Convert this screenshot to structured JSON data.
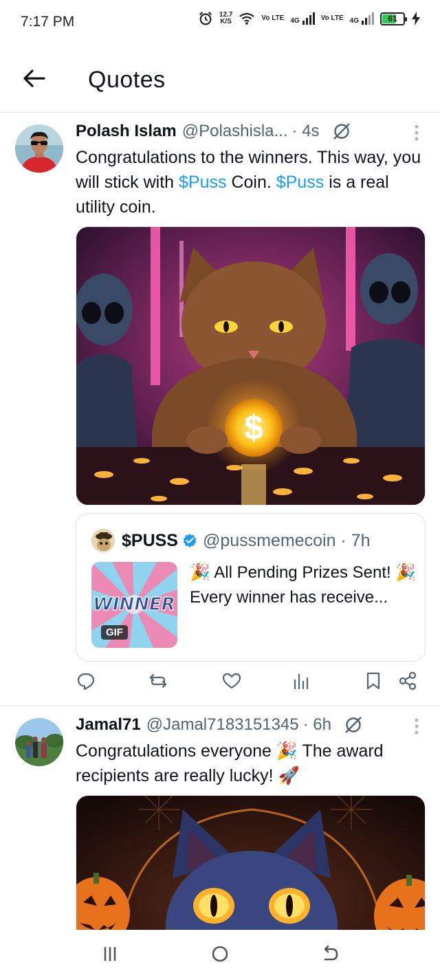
{
  "status_bar": {
    "time": "7:17 PM",
    "net_speed_value": "12.7",
    "net_speed_unit": "K/S",
    "sim1_label": "Vo LTE",
    "sim1_gen": "4G",
    "sim2_label": "Vo LTE",
    "sim2_gen": "4G",
    "battery_level": "61",
    "battery_fraction": 0.61
  },
  "header": {
    "title": "Quotes"
  },
  "posts": [
    {
      "author": "Polash Islam",
      "handle": "@Polashisla...",
      "time": "· 4s",
      "text_parts": [
        "Congratulations to the winners. This way, you will stick with ",
        "$Puss",
        " Coin. ",
        "$Puss",
        " is a real utility coin."
      ],
      "quote": {
        "name": "$PUSS",
        "handle": "@pussmemecoin · 7h",
        "thumb_text": "WINNER",
        "thumb_badge": "GIF",
        "text": "🎉 All Pending Prizes Sent! 🎉 Every winner has receive..."
      }
    },
    {
      "author": "Jamal71",
      "handle": "@Jamal7183151345",
      "time": "· 6h",
      "text": "Congratulations everyone 🎉 The award recipients are really lucky! 🚀"
    }
  ],
  "colors": {
    "link": "#1d9bf0",
    "muted": "#536471",
    "verified": "#1d9bf0"
  }
}
